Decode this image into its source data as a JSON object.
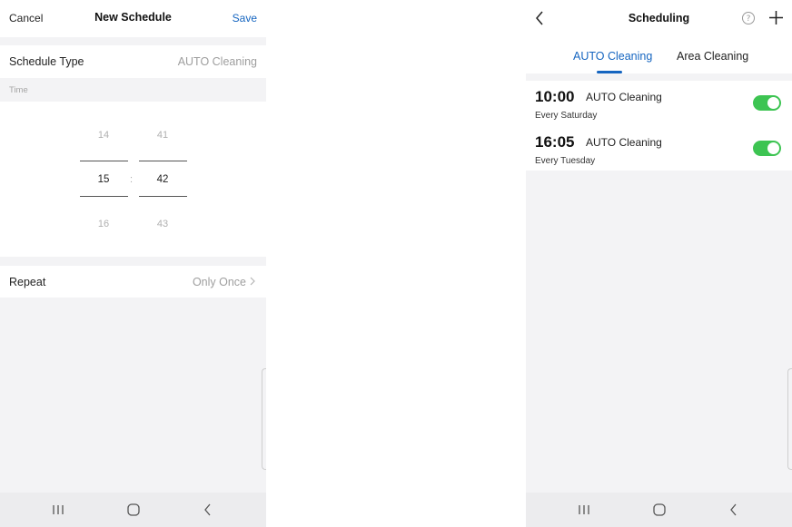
{
  "left": {
    "header": {
      "cancel_label": "Cancel",
      "title": "New Schedule",
      "save_label": "Save"
    },
    "schedule_type": {
      "label": "Schedule Type",
      "value": "AUTO Cleaning"
    },
    "time_section_label": "Time",
    "time_picker": {
      "hour_prev": "14",
      "hour_selected": "15",
      "hour_next": "16",
      "minute_prev": "41",
      "minute_selected": "42",
      "minute_next": "43",
      "separator": ":"
    },
    "repeat": {
      "label": "Repeat",
      "value": "Only Once"
    }
  },
  "right": {
    "header": {
      "title": "Scheduling"
    },
    "tabs": [
      {
        "label": "AUTO Cleaning",
        "active": true
      },
      {
        "label": "Area Cleaning",
        "active": false
      }
    ],
    "schedules": [
      {
        "time": "10:00",
        "mode": "AUTO Cleaning",
        "repeat": "Every Saturday",
        "enabled": true
      },
      {
        "time": "16:05",
        "mode": "AUTO Cleaning",
        "repeat": "Every Tuesday",
        "enabled": true
      }
    ]
  },
  "colors": {
    "accent": "#1565c0",
    "toggle_on": "#3dc452",
    "background": "#f3f3f5"
  },
  "icons": [
    "back-icon",
    "help-icon",
    "plus-icon",
    "chevron-right-icon",
    "recent-apps-icon",
    "home-icon",
    "nav-back-icon"
  ]
}
